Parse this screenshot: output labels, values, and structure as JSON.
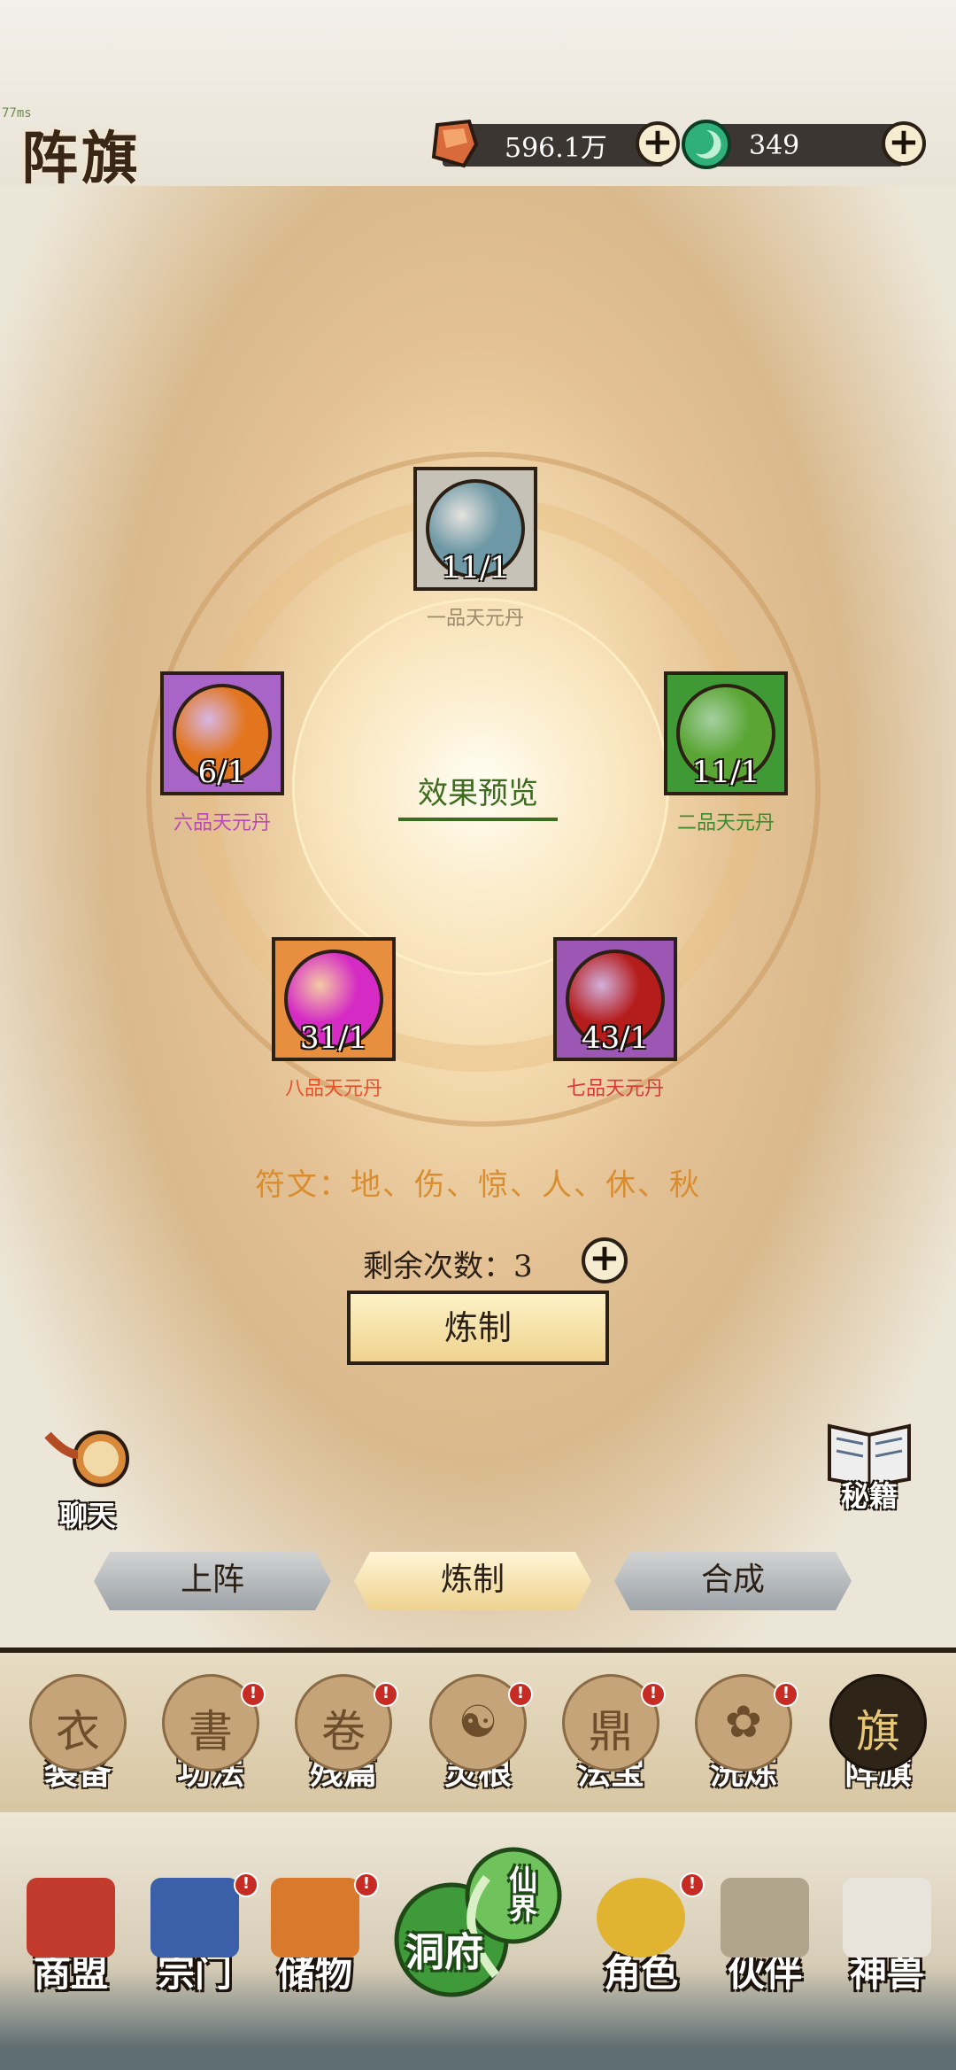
{
  "fps_text": "77ms",
  "header": {
    "title": "阵旗",
    "spirit_stone": "596.1万",
    "jade": "349"
  },
  "formation": {
    "slots": [
      {
        "count": "11/1",
        "label": "一品天元丹",
        "label_color": "#9b8a6a",
        "orb_color": "#6e98a5",
        "frame_color": "#c7c2b8"
      },
      {
        "count": "6/1",
        "label": "六品天元丹",
        "label_color": "#b84ab8",
        "orb_color": "#e2751e",
        "frame_color": "#a964c7"
      },
      {
        "count": "11/1",
        "label": "二品天元丹",
        "label_color": "#3d8b2d",
        "orb_color": "#5aa534",
        "frame_color": "#3f9a36"
      },
      {
        "count": "31/1",
        "label": "八品天元丹",
        "label_color": "#e8502a",
        "orb_color": "#d52ac4",
        "frame_color": "#e78f3e"
      },
      {
        "count": "43/1",
        "label": "七品天元丹",
        "label_color": "#d8393b",
        "orb_color": "#b51d1d",
        "frame_color": "#9b57b3"
      }
    ],
    "preview_label": "效果预览",
    "runes": "符文：地、伤、惊、人、休、秋",
    "remaining": "剩余次数：3",
    "refine_button": "炼制"
  },
  "side": {
    "chat": "聊天",
    "secrets": "秘籍"
  },
  "tabs": [
    {
      "label": "上阵",
      "active": false
    },
    {
      "label": "炼制",
      "active": true
    },
    {
      "label": "合成",
      "active": false
    }
  ],
  "subnav": [
    {
      "label": "装备",
      "glyph": "衣",
      "badge": false
    },
    {
      "label": "功法",
      "glyph": "書",
      "badge": true
    },
    {
      "label": "残篇",
      "glyph": "卷",
      "badge": true
    },
    {
      "label": "灵根",
      "glyph": "☯",
      "badge": true
    },
    {
      "label": "法宝",
      "glyph": "鼎",
      "badge": true
    },
    {
      "label": "洗炼",
      "glyph": "✿",
      "badge": true
    },
    {
      "label": "阵旗",
      "glyph": "旗",
      "badge": false,
      "active": true
    }
  ],
  "bottomnav": [
    {
      "label": "商盟",
      "badge": false,
      "color": "#c23a2b"
    },
    {
      "label": "宗门",
      "badge": true,
      "color": "#3b5fa8"
    },
    {
      "label": "储物",
      "badge": true,
      "color": "#d9792b"
    },
    {
      "label": "角色",
      "badge": true,
      "color": "#e0b431"
    },
    {
      "label": "伙伴",
      "badge": false,
      "color": "#b0a48c"
    },
    {
      "label": "神兽",
      "badge": false,
      "color": "#e8e4dc"
    }
  ],
  "cave": {
    "left": "洞府",
    "right": "仙界"
  },
  "colors": {
    "accent_green": "#3d6b1f",
    "rune_orange": "#d98d2f",
    "badge_red": "#c62b24"
  }
}
